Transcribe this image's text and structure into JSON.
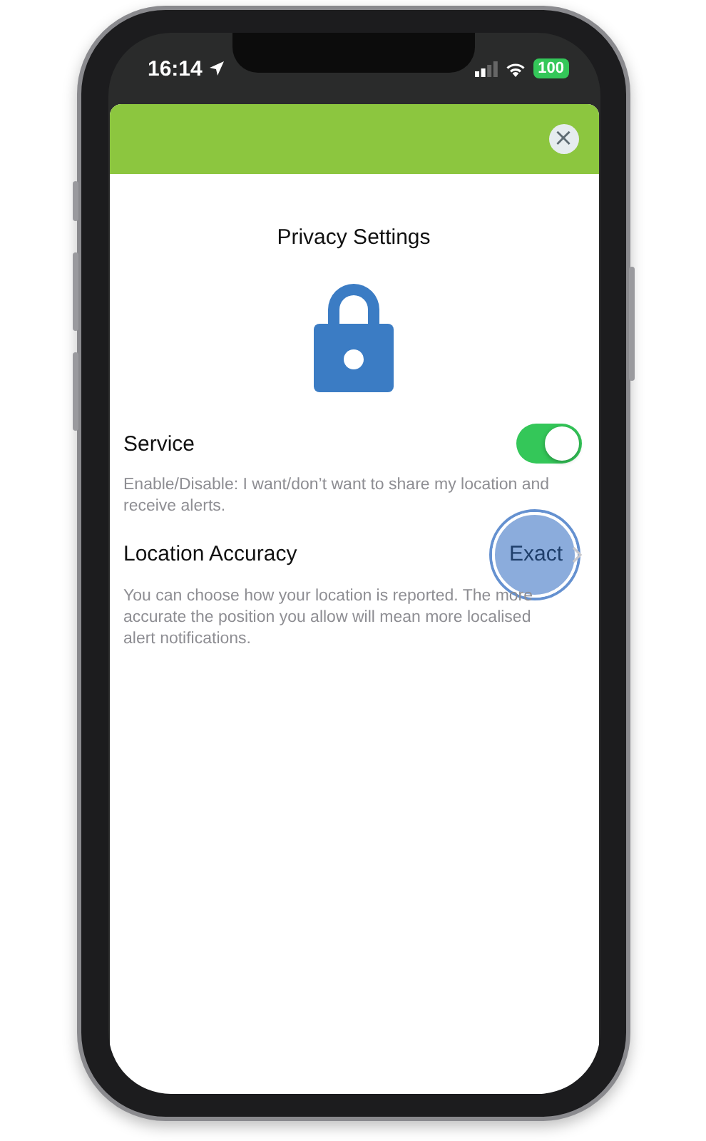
{
  "status_bar": {
    "time": "16:14",
    "battery": "100"
  },
  "header": {
    "close_label": "×"
  },
  "title": "Privacy Settings",
  "settings": [
    {
      "kind": "toggle",
      "label": "Service",
      "on": true,
      "description": "Enable/Disable: I want/don’t want to share my location and receive alerts."
    },
    {
      "kind": "select",
      "label": "Location Accuracy",
      "value": "Exact",
      "description": "You can choose how your location is reported. The more accurate the position you allow will mean more localised alert notifications."
    }
  ]
}
